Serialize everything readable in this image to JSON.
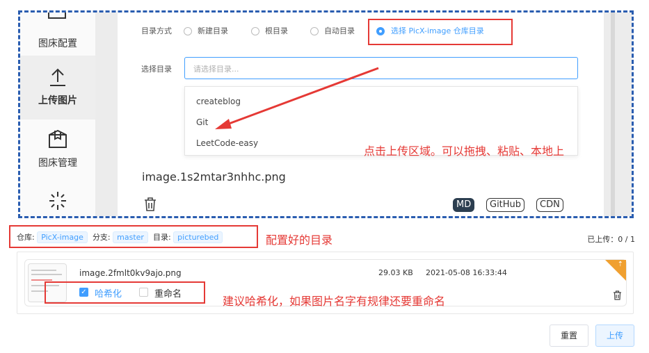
{
  "sidebar": {
    "items": [
      {
        "label": "图床配置",
        "icon": "settings-icon"
      },
      {
        "label": "上传图片",
        "icon": "upload-icon"
      },
      {
        "label": "图床管理",
        "icon": "box-icon"
      },
      {
        "label": "",
        "icon": "loading-icon"
      }
    ]
  },
  "dir_mode": {
    "label": "目录方式",
    "options": [
      "新建目录",
      "根目录",
      "自动目录",
      "选择 PicX-image 仓库目录"
    ],
    "selected": "选择 PicX-image 仓库目录"
  },
  "dir_select": {
    "label": "选择目录",
    "placeholder": "请选择目录...",
    "options": [
      "createblog",
      "Git",
      "LeetCode-easy"
    ]
  },
  "preview_file": {
    "name": "image.1s2mtar3nhhc.png",
    "tags": [
      "MD",
      "GitHub",
      "CDN"
    ]
  },
  "annotations": {
    "upload_area": "点击上传区域。可以拖拽、粘贴、本地上",
    "configured_dir": "配置好的目录",
    "hash_tip": "建议哈希化，如果图片名字有规律还要重命名"
  },
  "repo_info": {
    "repo_label": "仓库:",
    "repo": "PicX-image",
    "branch_label": "分支:",
    "branch": "master",
    "dir_label": "目录:",
    "dir": "picturebed",
    "uploaded": "已上传：0 / 1"
  },
  "upload_item": {
    "name": "image.2fmlt0kv9ajo.png",
    "size": "29.03 KB",
    "date": "2021-05-08 16:33:44",
    "hash_label": "哈希化",
    "hash_checked": true,
    "rename_label": "重命名",
    "rename_checked": false
  },
  "buttons": {
    "reset": "重置",
    "upload": "上传"
  },
  "colors": {
    "accent": "#409eff",
    "annotation_red": "#e53935",
    "dashed_border": "#2a5db0",
    "corner_badge": "#f0a030"
  }
}
